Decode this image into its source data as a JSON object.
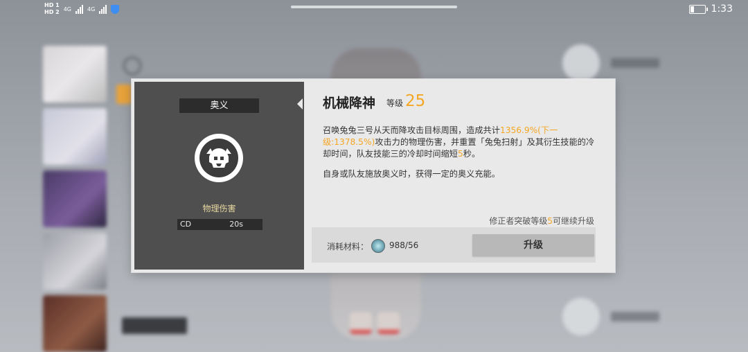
{
  "status_bar": {
    "hd1": "HD 1",
    "hd2": "HD 2",
    "net1": "4G",
    "net2": "4G",
    "time": "1:33",
    "battery_level": 0.25
  },
  "skill": {
    "category": "奥义",
    "damage_type": "物理伤害",
    "cd_label": "CD",
    "cd_value": "20s",
    "name": "机械降神",
    "level_label": "等级",
    "level": "25",
    "desc1_pre": "召唤兔兔三号从天而降攻击目标周围，造成共计",
    "desc1_highlight": "1356.9%(下一级:1378.5%)",
    "desc1_mid": "攻击力的物理伤害，并重置「兔兔扫射」及其衍生技能的冷却时间，队友技能三的冷却时间缩短",
    "desc1_num": "5",
    "desc1_end": "秒。",
    "desc2": "自身或队友施放奥义时，获得一定的奥义充能。",
    "breakthrough_pre": "修正者突破等级",
    "breakthrough_num": "5",
    "breakthrough_post": "可继续升级"
  },
  "cost": {
    "label": "消耗材料：",
    "value": "988/56",
    "icon": "crystal-material-icon"
  },
  "upgrade_label": "升级",
  "colors": {
    "accent": "#f5a623",
    "panel_dark": "#4f4f4f",
    "dialog_bg": "#e9e9ea"
  }
}
